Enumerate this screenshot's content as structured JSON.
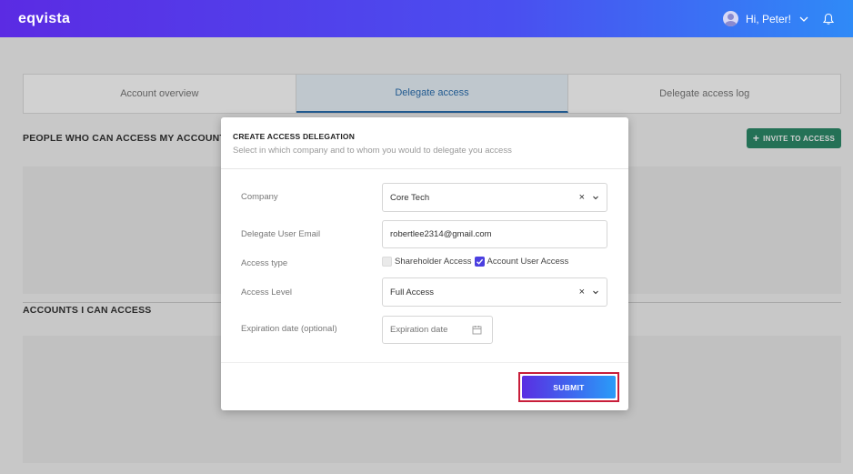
{
  "header": {
    "logo": "eqvista",
    "greeting": "Hi, Peter!"
  },
  "tabs": [
    {
      "label": "Account overview",
      "active": false
    },
    {
      "label": "Delegate access",
      "active": true
    },
    {
      "label": "Delegate access log",
      "active": false
    }
  ],
  "sections": {
    "people_title": "PEOPLE WHO CAN ACCESS MY ACCOUNT",
    "accounts_title": "ACCOUNTS I CAN ACCESS",
    "invite_label": "INVITE TO ACCESS"
  },
  "modal": {
    "title": "CREATE ACCESS DELEGATION",
    "subtitle": "Select in which company and to whom you would to delegate you access",
    "company_label": "Company",
    "company_value": "Core Tech",
    "email_label": "Delegate User Email",
    "email_value": "robertlee2314@gmail.com",
    "access_type_label": "Access type",
    "access_type_options": [
      {
        "label": "Shareholder Access",
        "checked": false
      },
      {
        "label": "Account User Access",
        "checked": true
      }
    ],
    "access_level_label": "Access Level",
    "access_level_value": "Full Access",
    "expiration_label": "Expiration date (optional)",
    "expiration_placeholder": "Expiration date",
    "submit_label": "SUBMIT"
  },
  "colors": {
    "brand_start": "#5b2be3",
    "brand_end": "#2f8af7",
    "invite_green": "#2d8a6a",
    "highlight": "#c81e3a"
  }
}
